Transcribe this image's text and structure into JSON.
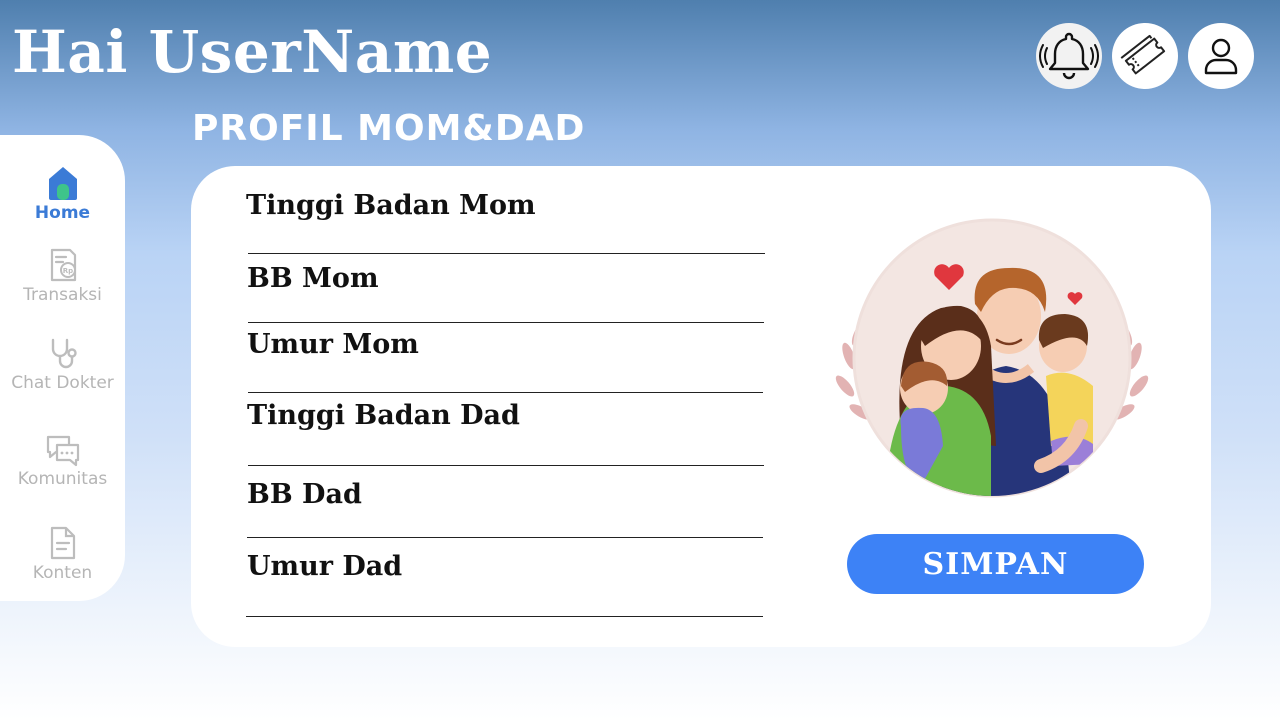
{
  "header": {
    "greeting": "Hai UserName",
    "icons": [
      "bell-icon",
      "ticket-icon",
      "user-icon"
    ]
  },
  "sidebar": {
    "items": [
      {
        "label": "Home",
        "icon": "home-icon",
        "active": true
      },
      {
        "label": "Transaksi",
        "icon": "receipt-icon",
        "active": false
      },
      {
        "label": "Chat Dokter",
        "icon": "stethoscope-icon",
        "active": false
      },
      {
        "label": "Komunitas",
        "icon": "chat-bubbles-icon",
        "active": false
      },
      {
        "label": "Konten",
        "icon": "document-icon",
        "active": false
      }
    ]
  },
  "main": {
    "title": "PROFIL MOM&DAD",
    "fields": [
      {
        "label": "Tinggi Badan Mom",
        "value": ""
      },
      {
        "label": "BB Mom",
        "value": ""
      },
      {
        "label": "Umur Mom",
        "value": ""
      },
      {
        "label": "Tinggi Badan Dad",
        "value": ""
      },
      {
        "label": "BB Dad",
        "value": ""
      },
      {
        "label": "Umur Dad",
        "value": ""
      }
    ],
    "illustration": "family-illustration",
    "save_label": "SIMPAN"
  },
  "colors": {
    "accent": "#3d82f6",
    "sidebar_active": "#3b7bd6",
    "sidebar_inactive": "#b5b5b5"
  }
}
